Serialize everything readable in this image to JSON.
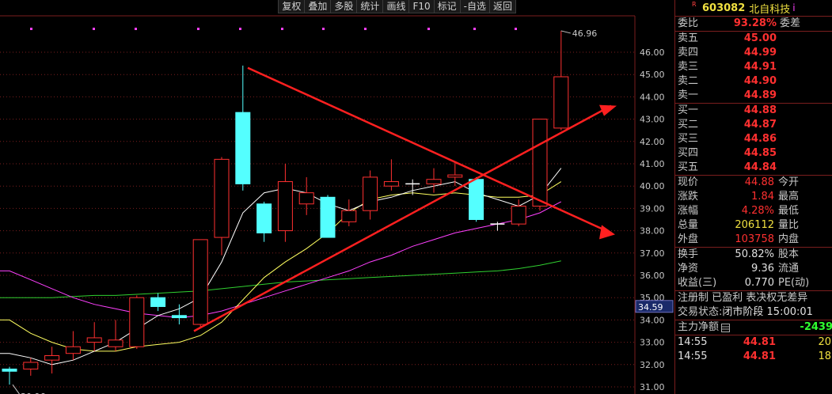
{
  "toolbar": [
    "复权",
    "叠加",
    "多股",
    "统计",
    "画线",
    "F10",
    "标记",
    "-自选",
    "返回"
  ],
  "chart": {
    "y_axis": {
      "min": 31,
      "max": 46,
      "ticks": [
        "46.00",
        "45.00",
        "44.00",
        "43.00",
        "42.00",
        "41.00",
        "40.00",
        "39.00",
        "38.00",
        "37.00",
        "36.00",
        "35.00",
        "34.00",
        "33.00",
        "32.00",
        "31.00"
      ]
    },
    "high_label": "46.96",
    "low_label": "30.96",
    "current_price_label": "34.59",
    "colors": {
      "up": "#ff3030",
      "down": "#54ffff",
      "ma5": "#ffffff",
      "ma10": "#ffff60",
      "ma20": "#ff40ff",
      "ma60": "#30d030",
      "annotation": "#ff2020"
    }
  },
  "chart_data": {
    "type": "candlestick",
    "ylim": [
      31,
      46.96
    ],
    "candles": [
      {
        "o": 31.8,
        "c": 31.7,
        "h": 31.9,
        "l": 31.1,
        "dir": "down"
      },
      {
        "o": 31.8,
        "c": 32.1,
        "h": 32.3,
        "l": 31.5,
        "dir": "up"
      },
      {
        "o": 32.2,
        "c": 32.4,
        "h": 32.8,
        "l": 31.6,
        "dir": "up"
      },
      {
        "o": 32.5,
        "c": 32.8,
        "h": 33.5,
        "l": 32.2,
        "dir": "up"
      },
      {
        "o": 33.0,
        "c": 33.2,
        "h": 33.9,
        "l": 32.6,
        "dir": "up"
      },
      {
        "o": 32.8,
        "c": 33.1,
        "h": 34.0,
        "l": 32.6,
        "dir": "up"
      },
      {
        "o": 32.8,
        "c": 35.0,
        "h": 35.1,
        "l": 32.7,
        "dir": "up"
      },
      {
        "o": 35.0,
        "c": 34.6,
        "h": 35.2,
        "l": 34.4,
        "dir": "down"
      },
      {
        "o": 34.2,
        "c": 34.1,
        "h": 34.7,
        "l": 33.8,
        "dir": "down"
      },
      {
        "o": 33.8,
        "c": 37.6,
        "h": 37.6,
        "l": 33.7,
        "dir": "up"
      },
      {
        "o": 37.7,
        "c": 41.2,
        "h": 41.3,
        "l": 36.9,
        "dir": "up"
      },
      {
        "o": 43.3,
        "c": 40.1,
        "h": 45.4,
        "l": 39.8,
        "dir": "down"
      },
      {
        "o": 39.2,
        "c": 37.9,
        "h": 39.3,
        "l": 37.5,
        "dir": "down"
      },
      {
        "o": 38.0,
        "c": 40.2,
        "h": 41.0,
        "l": 37.5,
        "dir": "up"
      },
      {
        "o": 39.2,
        "c": 39.7,
        "h": 40.4,
        "l": 38.7,
        "dir": "up"
      },
      {
        "o": 39.5,
        "c": 37.7,
        "h": 39.6,
        "l": 37.7,
        "dir": "down"
      },
      {
        "o": 38.4,
        "c": 38.9,
        "h": 39.4,
        "l": 38.2,
        "dir": "up"
      },
      {
        "o": 38.9,
        "c": 40.4,
        "h": 40.7,
        "l": 38.5,
        "dir": "up"
      },
      {
        "o": 40.0,
        "c": 40.2,
        "h": 41.2,
        "l": 39.8,
        "dir": "up"
      },
      {
        "o": 40.1,
        "c": 40.0,
        "h": 40.3,
        "l": 39.6,
        "dir": "cross"
      },
      {
        "o": 40.1,
        "c": 40.3,
        "h": 40.8,
        "l": 39.7,
        "dir": "up"
      },
      {
        "o": 40.4,
        "c": 40.5,
        "h": 41.1,
        "l": 40.0,
        "dir": "up"
      },
      {
        "o": 40.3,
        "c": 38.5,
        "h": 40.4,
        "l": 38.4,
        "dir": "down"
      },
      {
        "o": 38.3,
        "c": 38.3,
        "h": 38.4,
        "l": 38.0,
        "dir": "cross"
      },
      {
        "o": 38.3,
        "c": 39.1,
        "h": 39.4,
        "l": 38.2,
        "dir": "up"
      },
      {
        "o": 39.1,
        "c": 43.0,
        "h": 43.0,
        "l": 38.9,
        "dir": "up"
      },
      {
        "o": 42.6,
        "c": 44.9,
        "h": 46.96,
        "l": 42.5,
        "dir": "up"
      }
    ],
    "ma5": [
      32.5,
      32.3,
      32.0,
      32.2,
      32.6,
      33.0,
      33.6,
      34.2,
      34.5,
      35.0,
      36.6,
      38.8,
      39.7,
      39.9,
      39.7,
      39.2,
      38.9,
      39.3,
      39.5,
      39.8,
      40.0,
      40.2,
      39.7,
      39.4,
      39.1,
      39.6,
      40.8
    ],
    "ma10": [
      34.0,
      33.4,
      33.0,
      32.7,
      32.6,
      32.6,
      32.8,
      32.9,
      33.0,
      33.3,
      33.9,
      34.9,
      35.9,
      36.6,
      37.2,
      37.9,
      38.8,
      39.4,
      39.6,
      39.7,
      39.6,
      39.7,
      39.6,
      39.5,
      39.5,
      39.6,
      40.2
    ],
    "ma20": [
      36.2,
      35.8,
      35.4,
      35.0,
      34.7,
      34.5,
      34.3,
      34.2,
      34.1,
      34.2,
      34.4,
      34.7,
      35.0,
      35.3,
      35.6,
      35.9,
      36.2,
      36.6,
      36.9,
      37.3,
      37.6,
      37.9,
      38.1,
      38.3,
      38.5,
      38.8,
      39.3
    ],
    "ma60": [
      35.0,
      35.0,
      35.0,
      35.05,
      35.1,
      35.1,
      35.15,
      35.2,
      35.25,
      35.3,
      35.4,
      35.5,
      35.6,
      35.7,
      35.75,
      35.8,
      35.85,
      35.9,
      35.95,
      36.0,
      36.05,
      36.1,
      36.15,
      36.2,
      36.3,
      36.45,
      36.65
    ]
  },
  "quote": {
    "code": "603082",
    "name": "北自科技",
    "info_icon": "i",
    "r_mark": "R",
    "weibi": {
      "label": "委比",
      "value": "93.28%",
      "label2": "委差"
    },
    "asks": [
      {
        "label": "卖五",
        "price": "45.00"
      },
      {
        "label": "卖四",
        "price": "44.99"
      },
      {
        "label": "卖三",
        "price": "44.91"
      },
      {
        "label": "卖二",
        "price": "44.90"
      },
      {
        "label": "卖一",
        "price": "44.89"
      }
    ],
    "bids": [
      {
        "label": "买一",
        "price": "44.88"
      },
      {
        "label": "买二",
        "price": "44.87"
      },
      {
        "label": "买三",
        "price": "44.86"
      },
      {
        "label": "买四",
        "price": "44.85"
      },
      {
        "label": "买五",
        "price": "44.84"
      }
    ],
    "stats": [
      {
        "label": "现价",
        "value": "44.88",
        "label2": "今开",
        "color": "red"
      },
      {
        "label": "涨跌",
        "value": "1.84",
        "label2": "最高",
        "color": "red"
      },
      {
        "label": "涨幅",
        "value": "4.28%",
        "label2": "最低",
        "color": "red"
      },
      {
        "label": "总量",
        "value": "206112",
        "label2": "量比",
        "color": "yel"
      },
      {
        "label": "外盘",
        "value": "103758",
        "label2": "内盘",
        "color": "red"
      }
    ],
    "finance": [
      {
        "label": "换手",
        "value": "50.82%",
        "label2": "股本"
      },
      {
        "label": "净资",
        "value": "9.36",
        "label2": "流通"
      },
      {
        "label": "收益(三)",
        "value": "0.770",
        "label2": "PE(动)"
      }
    ],
    "notice1": "注册制 已盈利 表决权无差异",
    "notice2_label": "交易状态:",
    "notice2_value": "闭市阶段 15:00:01",
    "main_flow": {
      "label": "主力净额",
      "value": "-2439"
    },
    "ticks": [
      {
        "time": "14:55",
        "price": "44.81",
        "vol": "20"
      },
      {
        "time": "14:55",
        "price": "44.81",
        "vol": "18"
      }
    ]
  }
}
